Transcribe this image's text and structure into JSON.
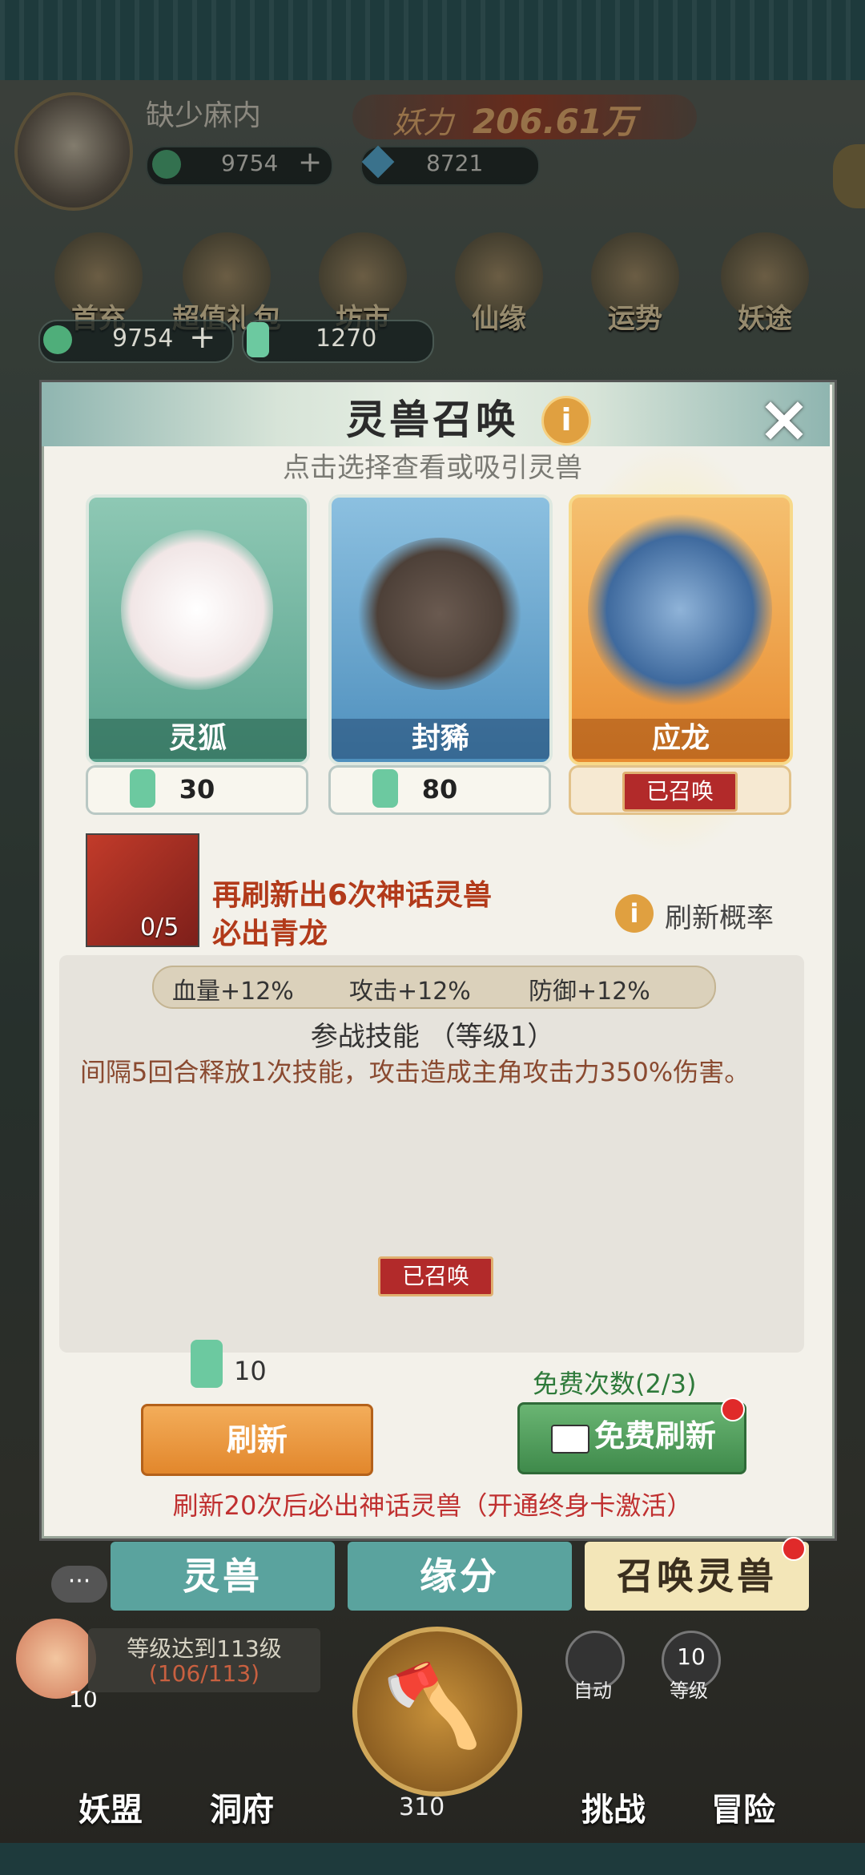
{
  "header": {
    "player_name": "缺少麻内",
    "power_label": "妖力",
    "power_value": "206.61万",
    "currency_a": "9754",
    "currency_b": "8721",
    "currency_add": "+"
  },
  "menu": {
    "items": [
      "首充",
      "超值礼包",
      "坊市",
      "仙缘",
      "运势",
      "妖途"
    ]
  },
  "overlay_currency": {
    "gem_count": "9754",
    "jade_count": "1270",
    "add": "+"
  },
  "modal": {
    "title": "灵兽召唤",
    "info_icon": "i",
    "close_icon": "×",
    "hint": "点击选择查看或吸引灵兽",
    "cards": [
      {
        "name": "灵狐",
        "cost": "30",
        "color": "#5aa38e"
      },
      {
        "name": "封豨",
        "cost": "80",
        "color": "#4e8fbd"
      },
      {
        "name": "应龙",
        "status": "已召唤",
        "color": "#e88c30"
      }
    ],
    "refresh_promo": {
      "count": "0/5",
      "line1": "再刷新出6次神话灵兽",
      "line2": "必出青龙",
      "rate_info_icon": "i",
      "rate_label": "刷新概率"
    },
    "stats": {
      "hp": "血量+12%",
      "atk": "攻击+12%",
      "def": "防御+12%"
    },
    "skill": {
      "title": "参战技能 （等级1）",
      "desc": "间隔5回合释放1次技能，攻击造成主角攻击力350%伤害。"
    },
    "panel_status": "已召唤",
    "refresh_cost": "10",
    "free_count": "免费次数(2/3)",
    "refresh_label": "刷新",
    "free_refresh_label": "免费刷新",
    "footer_note": "刷新20次后必出神话灵兽（开通终身卡激活）"
  },
  "tabs": [
    "灵兽",
    "缘分",
    "召唤灵兽"
  ],
  "hud": {
    "chat": "···",
    "peach_num": "10",
    "level_text": "等级达到113级",
    "level_progress": "(106/113)",
    "auto_label": "自动",
    "level_badge": "10",
    "level_label": "等级",
    "coin_count": "310"
  },
  "nav": [
    "妖盟",
    "洞府",
    "挑战",
    "冒险"
  ],
  "colors": {
    "accent_orange": "#e2872c",
    "accent_green": "#3f8a4b",
    "summoned_red": "#b22a2a",
    "tab_teal": "#5aa39e"
  }
}
